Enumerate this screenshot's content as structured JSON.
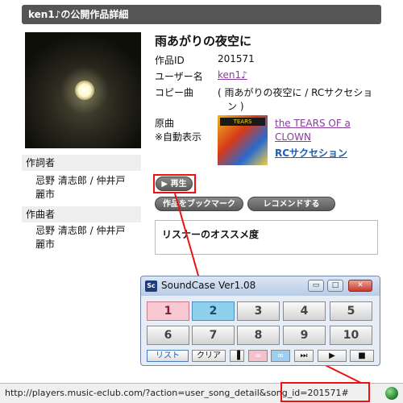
{
  "header": {
    "title": "ken1♪の公開作品詳細"
  },
  "song": {
    "title": "雨あがりの夜空に",
    "id_label": "作品ID",
    "id_value": "201571",
    "user_label": "ユーザー名",
    "user_value": "ken1♪",
    "copy_label": "コピー曲",
    "copy_value_line1": "( 雨あがりの夜空に / RCサクセショ",
    "copy_value_line2": "ン )",
    "original_label": "原曲",
    "auto_label": "※自動表示",
    "original_link": "the TEARS OF a",
    "original_link_line2": "CLOWN",
    "artist_link": "RCサクセション",
    "cover_text": "TEARS"
  },
  "sidebar": {
    "lyricist_label": "作詞者",
    "lyricist_line1": "忌野 清志郎 / 仲井戸",
    "lyricist_line2": "麗市",
    "composer_label": "作曲者",
    "composer_line1": "忌野 清志郎 / 仲井戸",
    "composer_line2": "麗市"
  },
  "buttons": {
    "play": "▶ 再生",
    "bookmark": "作品をブックマーク",
    "recommend": "レコメンドする"
  },
  "recommend_box": {
    "title": "リスナーのオススメ度"
  },
  "soundcase": {
    "title": "SoundCase Ver1.08",
    "logo": "Sc",
    "numbers": [
      "1",
      "2",
      "3",
      "4",
      "5",
      "6",
      "7",
      "8",
      "9",
      "10"
    ],
    "list_label": "リスト",
    "clear_label": "クリア",
    "minimize_glyph": "▭",
    "maximize_glyph": "□",
    "close_glyph": "✕",
    "next_glyph": "⏭",
    "play_glyph": "▶",
    "stop_glyph": "■",
    "loop_glyph": "∞",
    "vol_glyph": "▐"
  },
  "statusbar": {
    "url": "http://players.music-eclub.com/?action=user_song_detail&song_id=201571#"
  },
  "colors": {
    "highlight": "#e11111",
    "link": "#8a3aa0"
  }
}
